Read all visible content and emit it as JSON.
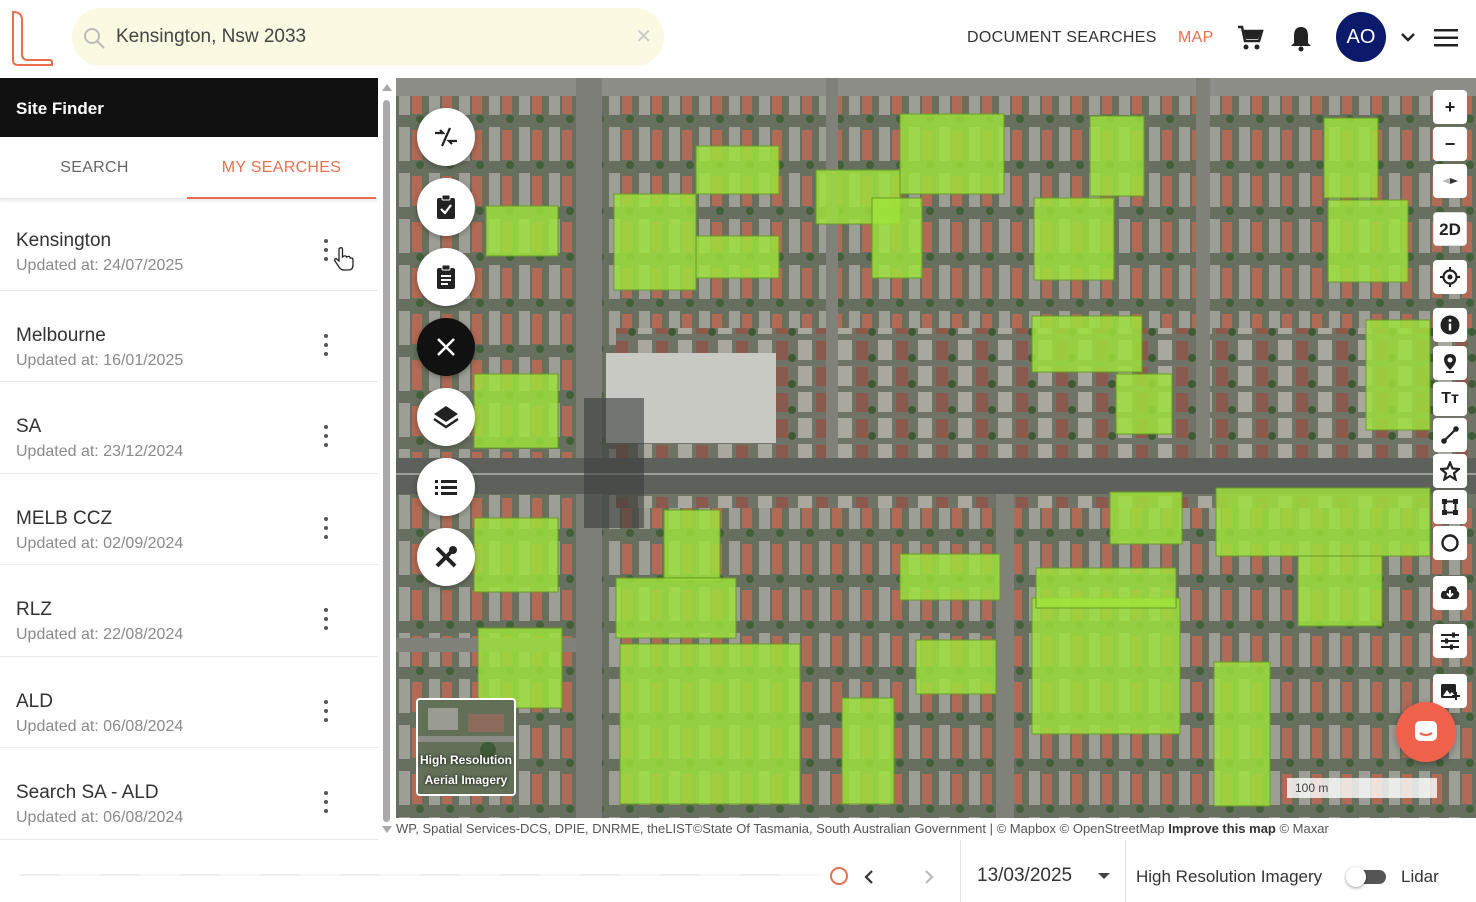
{
  "header": {
    "search": {
      "value": "Kensington, Nsw 2033",
      "placeholder": ""
    },
    "nav": {
      "document_searches": "DOCUMENT SEARCHES",
      "map": "MAP"
    },
    "avatar_initials": "AO",
    "accent_color": "#e8704f",
    "icons": [
      "logo-icon",
      "search-icon",
      "clear-icon",
      "cart-icon",
      "bell-icon",
      "chevron-down-icon",
      "menu-icon"
    ]
  },
  "sidebar": {
    "title": "Site Finder",
    "tabs": [
      {
        "label": "SEARCH",
        "active": false
      },
      {
        "label": "MY SEARCHES",
        "active": true
      }
    ],
    "items": [
      {
        "name": "Kensington",
        "updated": "Updated at: 24/07/2025"
      },
      {
        "name": "Melbourne",
        "updated": "Updated at: 16/01/2025"
      },
      {
        "name": "SA",
        "updated": "Updated at: 23/12/2024"
      },
      {
        "name": "MELB CCZ",
        "updated": "Updated at: 02/09/2024"
      },
      {
        "name": "RLZ",
        "updated": "Updated at: 22/08/2024"
      },
      {
        "name": "ALD",
        "updated": "Updated at: 06/08/2024"
      },
      {
        "name": "Search SA - ALD",
        "updated": "Updated at: 06/08/2024"
      }
    ]
  },
  "map": {
    "left_tools": [
      "collapse-icon",
      "clipboard-check-icon",
      "clipboard-icon",
      "close-icon",
      "layers-icon",
      "list-icon",
      "tools-icon"
    ],
    "thumbnail": {
      "line1": "High Resolution",
      "line2": "Aerial Imagery"
    },
    "right_tools": {
      "zoom_in": "+",
      "zoom_out": "−",
      "mode_2d": "2D",
      "text_tool": "Tт"
    },
    "scale_label": "100 m",
    "attribution": {
      "text": "WP, Spatial Services-DCS, DPIE, DNRME, theLIST©State Of Tasmania, South Australian Government | © Mapbox © OpenStreetMap ",
      "improve": "Improve this map",
      "maxar": " © Maxar"
    },
    "highlight_color": "#9fe33a"
  },
  "bottom": {
    "date": "13/03/2025",
    "imagery_label": "High Resolution Imagery",
    "lidar_label": "Lidar",
    "lidar_on": false
  }
}
